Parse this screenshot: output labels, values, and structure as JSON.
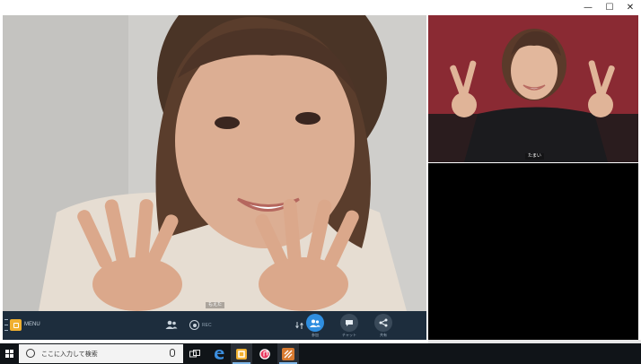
{
  "window": {
    "minimize_glyph": "—",
    "maximize_glyph": "☐",
    "close_glyph": "✕"
  },
  "main_video": {
    "participant_name": "もえた"
  },
  "side_video": {
    "participant_name": "たまい"
  },
  "controls": {
    "menu_label": "MENU",
    "rec_label": "REC",
    "participants_label": "参加",
    "chat_label": "チャット",
    "share_label": "共有"
  },
  "taskbar": {
    "search_placeholder": "ここに入力して検索"
  },
  "colors": {
    "controls_bg": "#1d2d3d",
    "participants_active": "#2f8ee0",
    "taskbar_bg": "#101418",
    "menu_accent": "#f0b030"
  },
  "icons": [
    "minimize-icon",
    "maximize-icon",
    "close-icon",
    "hamburger-icon",
    "menu-app-icon",
    "people-icon",
    "record-icon",
    "swap-camera-icon",
    "participants-icon",
    "chat-icon",
    "share-icon",
    "windows-start-icon",
    "search-icon",
    "microphone-icon",
    "task-view-icon",
    "edge-icon",
    "app-icon",
    "music-icon",
    "app-icon-2"
  ]
}
